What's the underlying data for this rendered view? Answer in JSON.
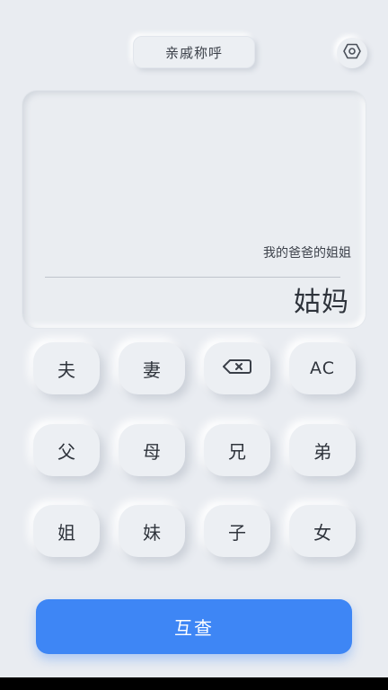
{
  "header": {
    "title": "亲戚称呼",
    "settings_icon": "settings-icon"
  },
  "display": {
    "expression": "我的爸爸的姐姐",
    "result": "姑妈"
  },
  "keypad": {
    "row1": [
      "夫",
      "妻",
      "delete",
      "AC"
    ],
    "row2": [
      "父",
      "母",
      "兄",
      "弟"
    ],
    "row3": [
      "姐",
      "妹",
      "子",
      "女"
    ]
  },
  "action": {
    "label": "互查"
  },
  "colors": {
    "background": "#e9ecf1",
    "accent": "#3e86f5"
  }
}
